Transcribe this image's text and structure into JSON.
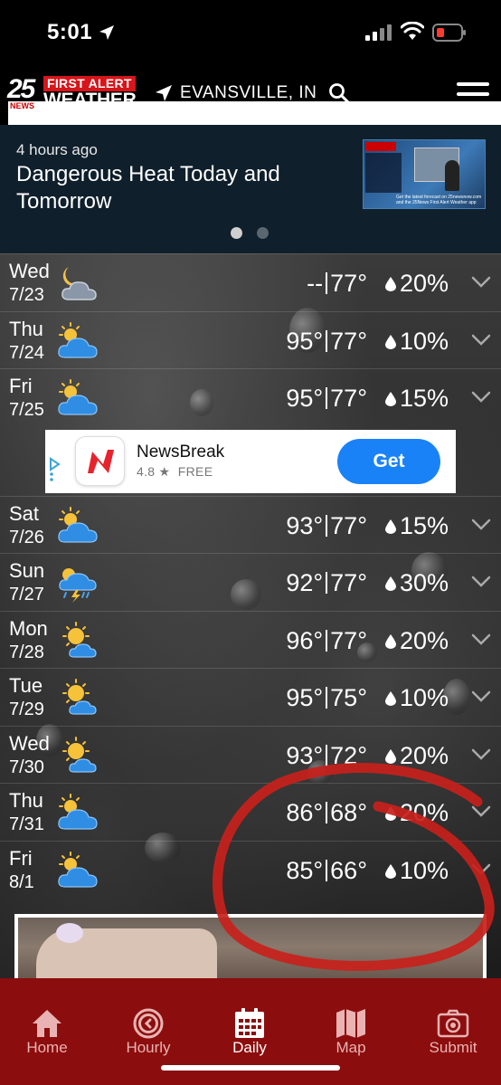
{
  "status_bar": {
    "time": "5:01"
  },
  "header": {
    "logo": {
      "number": "25",
      "news": "NEWS",
      "first_alert": "FIRST ALERT",
      "weather": "WEATHER"
    },
    "location": "EVANSVILLE, IN"
  },
  "news": {
    "ago": "4 hours ago",
    "headline": "Dangerous Heat Today and Tomorrow",
    "thumbnail_caption": "Get the latest forecast on 25newsnow.com and the 25News First Alert Weather app",
    "page_count": 2,
    "active_page": 1
  },
  "forecast": [
    {
      "day": "Wed",
      "date": "7/23",
      "icon": "night-cloud-moon-icon",
      "high": "--",
      "low": "77°",
      "precip": "20%"
    },
    {
      "day": "Thu",
      "date": "7/24",
      "icon": "partly-cloudy-icon",
      "high": "95°",
      "low": "77°",
      "precip": "10%"
    },
    {
      "day": "Fri",
      "date": "7/25",
      "icon": "partly-cloudy-icon",
      "high": "95°",
      "low": "77°",
      "precip": "15%"
    },
    {
      "day": "Sat",
      "date": "7/26",
      "icon": "partly-cloudy-icon",
      "high": "93°",
      "low": "77°",
      "precip": "15%"
    },
    {
      "day": "Sun",
      "date": "7/27",
      "icon": "thunderstorm-icon",
      "high": "92°",
      "low": "77°",
      "precip": "30%"
    },
    {
      "day": "Mon",
      "date": "7/28",
      "icon": "mostly-sunny-icon",
      "high": "96°",
      "low": "77°",
      "precip": "20%"
    },
    {
      "day": "Tue",
      "date": "7/29",
      "icon": "mostly-sunny-icon",
      "high": "95°",
      "low": "75°",
      "precip": "10%"
    },
    {
      "day": "Wed",
      "date": "7/30",
      "icon": "mostly-sunny-icon",
      "high": "93°",
      "low": "72°",
      "precip": "20%"
    },
    {
      "day": "Thu",
      "date": "7/31",
      "icon": "partly-cloudy-icon",
      "high": "86°",
      "low": "68°",
      "precip": "20%"
    },
    {
      "day": "Fri",
      "date": "8/1",
      "icon": "partly-cloudy-icon",
      "high": "85°",
      "low": "66°",
      "precip": "10%"
    }
  ],
  "ad": {
    "app_name": "NewsBreak",
    "rating": "4.8 ★",
    "price": "FREE",
    "cta": "Get"
  },
  "tabs": [
    {
      "id": "home",
      "label": "Home",
      "icon": "home-icon"
    },
    {
      "id": "hourly",
      "label": "Hourly",
      "icon": "clock-icon"
    },
    {
      "id": "daily",
      "label": "Daily",
      "icon": "calendar-icon",
      "active": true
    },
    {
      "id": "map",
      "label": "Map",
      "icon": "map-icon"
    },
    {
      "id": "submit",
      "label": "Submit",
      "icon": "camera-icon"
    }
  ],
  "colors": {
    "brand_red": "#d7151b",
    "tab_bar": "#8c0d0d",
    "ad_button": "#1a82f7",
    "news_panel": "#0f1f2c",
    "annotation": "#c8211b"
  }
}
